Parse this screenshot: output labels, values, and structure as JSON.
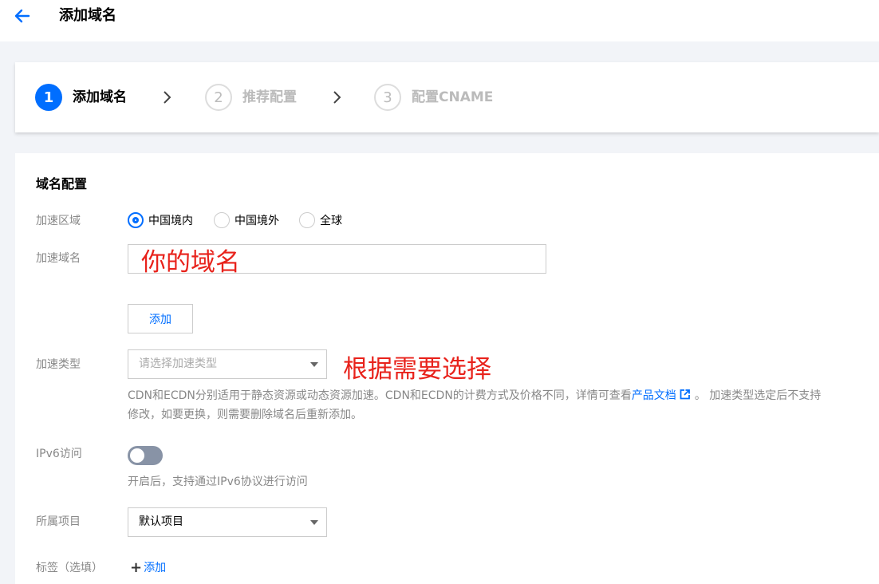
{
  "header": {
    "title": "添加域名"
  },
  "steps": [
    {
      "number": "1",
      "label": "添加域名"
    },
    {
      "number": "2",
      "label": "推荐配置"
    },
    {
      "number": "3",
      "label": "配置CNAME"
    }
  ],
  "section": {
    "title": "域名配置"
  },
  "region": {
    "label": "加速区域",
    "options": [
      "中国境内",
      "中国境外",
      "全球"
    ],
    "selected": "中国境内"
  },
  "domain": {
    "label": "加速域名",
    "annotation": "你的域名",
    "add_label": "添加"
  },
  "accel_type": {
    "label": "加速类型",
    "placeholder": "请选择加速类型",
    "annotation": "根据需要选择",
    "help_prefix": "CDN和ECDN分别适用于静态资源或动态资源加速。CDN和ECDN的计费方式及价格不同，详情可查看",
    "help_link": "产品文档",
    "help_suffix_line1": "。 加速类型选定后不支持",
    "help_line2": "修改，如要更换，则需要删除域名后重新添加。"
  },
  "ipv6": {
    "label": "IPv6访问",
    "enabled": false,
    "help": "开启后，支持通过IPv6协议进行访问"
  },
  "project": {
    "label": "所属项目",
    "value": "默认项目"
  },
  "tags": {
    "label": "标签（选填）",
    "add_label": "添加"
  },
  "colors": {
    "accent": "#006eff",
    "annotation": "#e8221b"
  }
}
